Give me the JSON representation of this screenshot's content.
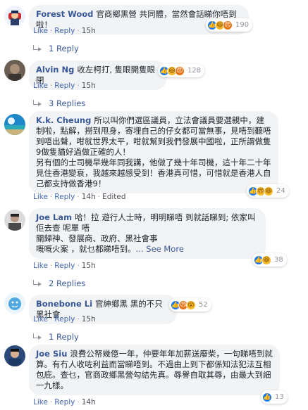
{
  "comments": [
    {
      "author": "Forest Wood",
      "text": "官商鄉黑營 共同體，當然會話睇你唔到啦！",
      "reactions": [
        "like",
        "haha",
        "angry"
      ],
      "count": "190",
      "actions": {
        "like": "Like",
        "reply": "Reply",
        "time": "15h",
        "edited": ""
      }
    },
    {
      "author": "Alvin Ng",
      "text": "收左柯打, 隻眼開隻眼閉",
      "reactions": [
        "like",
        "haha",
        "angry"
      ],
      "count": "128",
      "actions": {
        "like": "Like",
        "reply": "Reply",
        "time": "15h",
        "edited": ""
      }
    },
    {
      "author": "K.k. Cheung",
      "text": "所以叫你們選區議員，立法會議員要選親中，建制啦，點解，撈到甩身，寄埋自己的仔女都可當無事，見唔到聽唔到唔出聲，咁就世界太平，咁就幫到我們發展中國啦，正所謂做隻9做隻貓好過做正確的人！\n另有個的士司機早幾年同我講，他做了幾十年司機，這十年二十年見住香港變衰，我越來越感受到！香港真可惜，可惜就是香港人自己都支持做香港9！",
      "reactions": [
        "like",
        "sad",
        "haha"
      ],
      "count": "24",
      "actions": {
        "like": "Like",
        "reply": "Reply",
        "time": "14h",
        "edited": "Edited"
      }
    },
    {
      "author": "Joe Lam",
      "text": "哈！拉 遊行人士時，明明睇唔 到就話睇到; 依家叫佢去查 呢單 唔\n關歸神、發展商、政府、黑社會事\n嘅嘅火案 ，就乜都睇唔到。",
      "see_more": "... See More",
      "reactions": [
        "like",
        "haha"
      ],
      "count": "38",
      "actions": {
        "like": "Like",
        "reply": "Reply",
        "time": "15h",
        "edited": ""
      }
    },
    {
      "author": "Bonebone Li",
      "text": "官紳鄉黑 黑的不只黑社會",
      "reactions": [
        "like",
        "angry",
        "wow"
      ],
      "count": "52",
      "actions": {
        "like": "Like",
        "reply": "Reply",
        "time": "15h",
        "edited": ""
      }
    },
    {
      "author": "Joe Siu",
      "text": "浪費公帑幾億一年，仲要年年加薪送廢柴，一句睇唔到就算。有冇人收咗利益而當睇唔到。不過由上到下都係知法犯法互相包庇。查乜，官商政鄉黑營勾結先真。辱譽自取其辱，由最大到細一九樣。",
      "reactions": [
        "like"
      ],
      "count": "13",
      "actions": {
        "like": "Like",
        "reply": "Reply",
        "time": "14h",
        "edited": ""
      }
    }
  ],
  "reply_links": [
    {
      "label": "1 Reply"
    },
    {
      "label": "3 Replies"
    },
    {
      "label": "2 Replies"
    },
    {
      "label": "1 Reply"
    }
  ],
  "reaction_glyphs": {
    "like": "👍",
    "haha": "😆",
    "angry": "😠",
    "sad": "😢",
    "wow": "😮"
  },
  "colors": {
    "link": "#385898",
    "bubble": "#f2f3f5",
    "like_blue": "#1877f2"
  }
}
